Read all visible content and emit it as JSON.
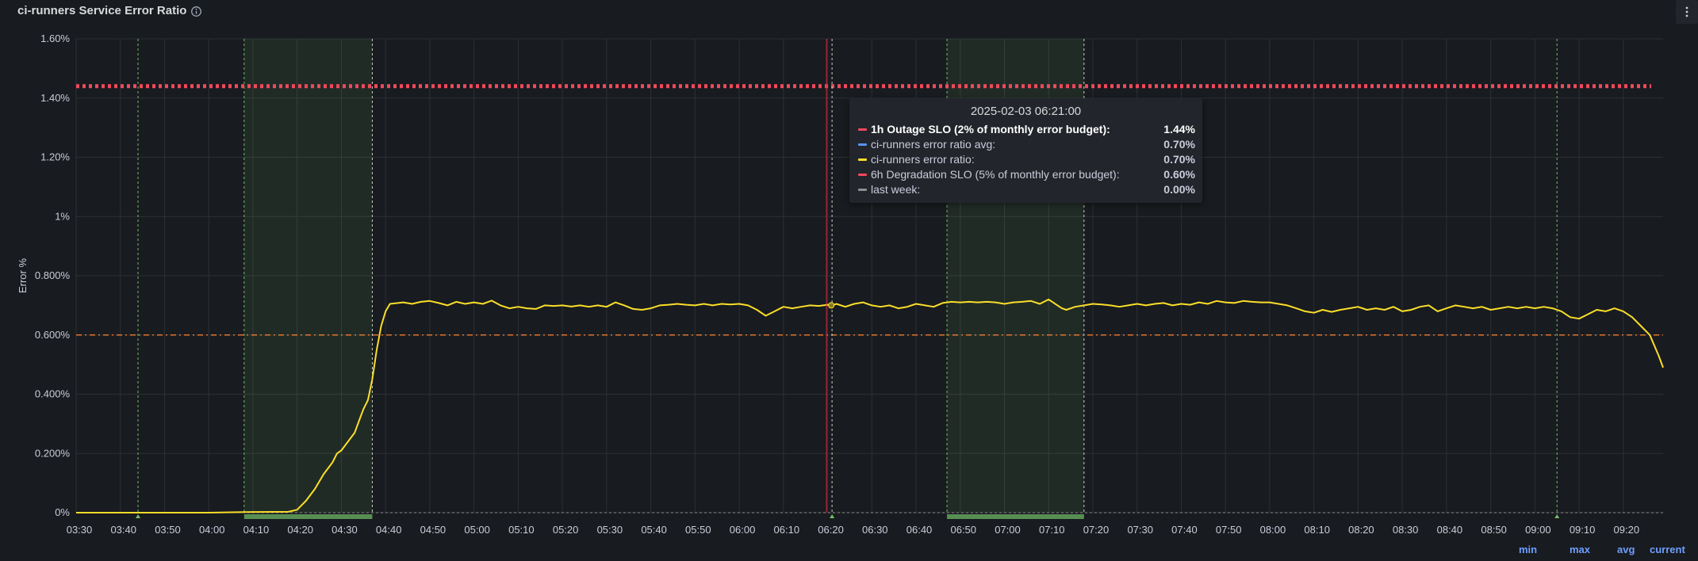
{
  "panel": {
    "title": "ci-runners Service Error Ratio",
    "info_icon": "info-circle-icon",
    "menu_icon": "vertical-ellipsis-icon"
  },
  "legend_links": {
    "min": "min",
    "max": "max",
    "avg": "avg",
    "current": "current"
  },
  "tooltip": {
    "time": "2025-02-03 06:21:00",
    "rows": [
      {
        "label": "1h Outage SLO (2% of monthly error budget):",
        "value": "1.44%",
        "color": "#f2495c",
        "active": true
      },
      {
        "label": "ci-runners error ratio avg:",
        "value": "0.70%",
        "color": "#5794f2",
        "active": false
      },
      {
        "label": "ci-runners error ratio:",
        "value": "0.70%",
        "color": "#fade2a",
        "active": false
      },
      {
        "label": "6h Degradation SLO (5% of monthly error budget):",
        "value": "0.60%",
        "color": "#f2495c",
        "active": false
      },
      {
        "label": "last week:",
        "value": "0.00%",
        "color": "#8e8e8e",
        "active": false
      }
    ]
  },
  "colors": {
    "background": "#181b1f",
    "grid": "#2c3035",
    "error_ratio": "#fade2a",
    "outage_slo": "#f2495c",
    "degradation_slo": "#e0752d",
    "annotation_line": "#73bf69",
    "annotation_region": "#73bf69",
    "cursor_line": "#e02f44",
    "axis_text": "#ccccdc"
  },
  "chart_data": {
    "type": "line",
    "ylabel": "Error %",
    "ylim": [
      0,
      1.6
    ],
    "y_ticks": [
      {
        "value": 0,
        "label": "0%"
      },
      {
        "value": 0.2,
        "label": "0.200%"
      },
      {
        "value": 0.4,
        "label": "0.400%"
      },
      {
        "value": 0.6,
        "label": "0.600%"
      },
      {
        "value": 0.8,
        "label": "0.800%"
      },
      {
        "value": 1.0,
        "label": "1%"
      },
      {
        "value": 1.2,
        "label": "1.20%"
      },
      {
        "value": 1.4,
        "label": "1.40%"
      },
      {
        "value": 1.6,
        "label": "1.60%"
      }
    ],
    "x_range": [
      "03:30",
      "09:29"
    ],
    "x_tick_labels": [
      "03:30",
      "03:40",
      "03:50",
      "04:00",
      "04:10",
      "04:20",
      "04:30",
      "04:40",
      "04:50",
      "05:00",
      "05:10",
      "05:20",
      "05:30",
      "05:40",
      "05:50",
      "06:00",
      "06:10",
      "06:20",
      "06:30",
      "06:40",
      "06:50",
      "07:00",
      "07:10",
      "07:20",
      "07:30",
      "07:40",
      "07:50",
      "08:00",
      "08:10",
      "08:20",
      "08:30",
      "08:40",
      "08:50",
      "09:00",
      "09:10",
      "09:20"
    ],
    "grid": true,
    "series": [
      {
        "name": "ci-runners error ratio",
        "color": "#fade2a",
        "points": [
          [
            "03:30",
            0
          ],
          [
            "04:00",
            0
          ],
          [
            "04:08",
            0.002
          ],
          [
            "04:18",
            0.003
          ],
          [
            "04:20",
            0.01
          ],
          [
            "04:22",
            0.04
          ],
          [
            "04:24",
            0.08
          ],
          [
            "04:26",
            0.13
          ],
          [
            "04:28",
            0.17
          ],
          [
            "04:29",
            0.2
          ],
          [
            "04:30",
            0.21
          ],
          [
            "04:31",
            0.23
          ],
          [
            "04:33",
            0.27
          ],
          [
            "04:34",
            0.31
          ],
          [
            "04:35",
            0.35
          ],
          [
            "04:36",
            0.38
          ],
          [
            "04:37",
            0.45
          ],
          [
            "04:38",
            0.55
          ],
          [
            "04:39",
            0.63
          ],
          [
            "04:40",
            0.68
          ],
          [
            "04:41",
            0.705
          ],
          [
            "04:44",
            0.71
          ],
          [
            "04:46",
            0.705
          ],
          [
            "04:48",
            0.712
          ],
          [
            "04:50",
            0.715
          ],
          [
            "04:52",
            0.708
          ],
          [
            "04:54",
            0.7
          ],
          [
            "04:56",
            0.712
          ],
          [
            "04:58",
            0.705
          ],
          [
            "05:00",
            0.71
          ],
          [
            "05:02",
            0.705
          ],
          [
            "05:04",
            0.716
          ],
          [
            "05:06",
            0.7
          ],
          [
            "05:08",
            0.69
          ],
          [
            "05:10",
            0.695
          ],
          [
            "05:12",
            0.69
          ],
          [
            "05:14",
            0.688
          ],
          [
            "05:16",
            0.7
          ],
          [
            "05:18",
            0.698
          ],
          [
            "05:20",
            0.7
          ],
          [
            "05:22",
            0.696
          ],
          [
            "05:24",
            0.7
          ],
          [
            "05:26",
            0.695
          ],
          [
            "05:28",
            0.7
          ],
          [
            "05:30",
            0.695
          ],
          [
            "05:32",
            0.71
          ],
          [
            "05:34",
            0.7
          ],
          [
            "05:36",
            0.688
          ],
          [
            "05:38",
            0.685
          ],
          [
            "05:40",
            0.69
          ],
          [
            "05:42",
            0.7
          ],
          [
            "05:44",
            0.702
          ],
          [
            "05:46",
            0.705
          ],
          [
            "05:48",
            0.702
          ],
          [
            "05:50",
            0.7
          ],
          [
            "05:52",
            0.705
          ],
          [
            "05:54",
            0.7
          ],
          [
            "05:56",
            0.705
          ],
          [
            "05:58",
            0.703
          ],
          [
            "06:00",
            0.705
          ],
          [
            "06:02",
            0.7
          ],
          [
            "06:04",
            0.685
          ],
          [
            "06:06",
            0.665
          ],
          [
            "06:08",
            0.68
          ],
          [
            "06:10",
            0.695
          ],
          [
            "06:12",
            0.69
          ],
          [
            "06:14",
            0.695
          ],
          [
            "06:16",
            0.7
          ],
          [
            "06:18",
            0.698
          ],
          [
            "06:20",
            0.702
          ],
          [
            "06:21",
            0.7
          ],
          [
            "06:22",
            0.705
          ],
          [
            "06:24",
            0.695
          ],
          [
            "06:26",
            0.705
          ],
          [
            "06:28",
            0.71
          ],
          [
            "06:30",
            0.7
          ],
          [
            "06:32",
            0.695
          ],
          [
            "06:34",
            0.7
          ],
          [
            "06:36",
            0.69
          ],
          [
            "06:38",
            0.695
          ],
          [
            "06:40",
            0.705
          ],
          [
            "06:42",
            0.7
          ],
          [
            "06:44",
            0.695
          ],
          [
            "06:46",
            0.708
          ],
          [
            "06:48",
            0.712
          ],
          [
            "06:50",
            0.71
          ],
          [
            "06:52",
            0.712
          ],
          [
            "06:54",
            0.71
          ],
          [
            "06:56",
            0.712
          ],
          [
            "06:58",
            0.71
          ],
          [
            "07:00",
            0.705
          ],
          [
            "07:02",
            0.71
          ],
          [
            "07:04",
            0.712
          ],
          [
            "07:06",
            0.715
          ],
          [
            "07:08",
            0.705
          ],
          [
            "07:10",
            0.72
          ],
          [
            "07:12",
            0.7
          ],
          [
            "07:13",
            0.69
          ],
          [
            "07:14",
            0.685
          ],
          [
            "07:16",
            0.695
          ],
          [
            "07:18",
            0.7
          ],
          [
            "07:20",
            0.705
          ],
          [
            "07:22",
            0.703
          ],
          [
            "07:24",
            0.7
          ],
          [
            "07:26",
            0.695
          ],
          [
            "07:28",
            0.7
          ],
          [
            "07:30",
            0.705
          ],
          [
            "07:32",
            0.7
          ],
          [
            "07:34",
            0.705
          ],
          [
            "07:36",
            0.708
          ],
          [
            "07:38",
            0.7
          ],
          [
            "07:40",
            0.705
          ],
          [
            "07:42",
            0.702
          ],
          [
            "07:44",
            0.71
          ],
          [
            "07:46",
            0.705
          ],
          [
            "07:48",
            0.715
          ],
          [
            "07:50",
            0.71
          ],
          [
            "07:52",
            0.708
          ],
          [
            "07:54",
            0.715
          ],
          [
            "07:56",
            0.712
          ],
          [
            "07:58",
            0.71
          ],
          [
            "08:00",
            0.71
          ],
          [
            "08:02",
            0.705
          ],
          [
            "08:04",
            0.7
          ],
          [
            "08:06",
            0.69
          ],
          [
            "08:08",
            0.68
          ],
          [
            "08:10",
            0.675
          ],
          [
            "08:12",
            0.685
          ],
          [
            "08:14",
            0.678
          ],
          [
            "08:16",
            0.685
          ],
          [
            "08:18",
            0.69
          ],
          [
            "08:20",
            0.695
          ],
          [
            "08:22",
            0.685
          ],
          [
            "08:24",
            0.69
          ],
          [
            "08:26",
            0.685
          ],
          [
            "08:28",
            0.695
          ],
          [
            "08:30",
            0.68
          ],
          [
            "08:32",
            0.685
          ],
          [
            "08:34",
            0.695
          ],
          [
            "08:36",
            0.7
          ],
          [
            "08:38",
            0.68
          ],
          [
            "08:40",
            0.69
          ],
          [
            "08:42",
            0.7
          ],
          [
            "08:44",
            0.695
          ],
          [
            "08:46",
            0.69
          ],
          [
            "08:48",
            0.695
          ],
          [
            "08:50",
            0.685
          ],
          [
            "08:52",
            0.69
          ],
          [
            "08:54",
            0.695
          ],
          [
            "08:56",
            0.69
          ],
          [
            "08:58",
            0.695
          ],
          [
            "09:00",
            0.69
          ],
          [
            "09:02",
            0.695
          ],
          [
            "09:04",
            0.69
          ],
          [
            "09:06",
            0.68
          ],
          [
            "09:08",
            0.66
          ],
          [
            "09:10",
            0.655
          ],
          [
            "09:12",
            0.67
          ],
          [
            "09:14",
            0.685
          ],
          [
            "09:16",
            0.68
          ],
          [
            "09:18",
            0.69
          ],
          [
            "09:20",
            0.68
          ],
          [
            "09:22",
            0.66
          ],
          [
            "09:24",
            0.63
          ],
          [
            "09:26",
            0.6
          ],
          [
            "09:28",
            0.53
          ],
          [
            "09:29",
            0.49
          ]
        ]
      },
      {
        "name": "1h Outage SLO (2% of monthly error budget)",
        "color": "#f2495c",
        "style": "dotted",
        "value": 1.44
      },
      {
        "name": "6h Degradation SLO (5% of monthly error budget)",
        "color": "#e0752d",
        "style": "dash-dot",
        "value": 0.6
      },
      {
        "name": "ci-runners error ratio avg",
        "color": "#5794f2",
        "value": 0.7
      },
      {
        "name": "last week",
        "color": "#8e8e8e",
        "value": 0.0
      }
    ],
    "annotations": {
      "points": [
        "03:44",
        "06:21",
        "09:05"
      ],
      "regions": [
        [
          "04:08",
          "04:37"
        ],
        [
          "06:47",
          "07:18"
        ]
      ]
    },
    "cursor_time": "06:21",
    "legend_placement": "bottom-right"
  }
}
